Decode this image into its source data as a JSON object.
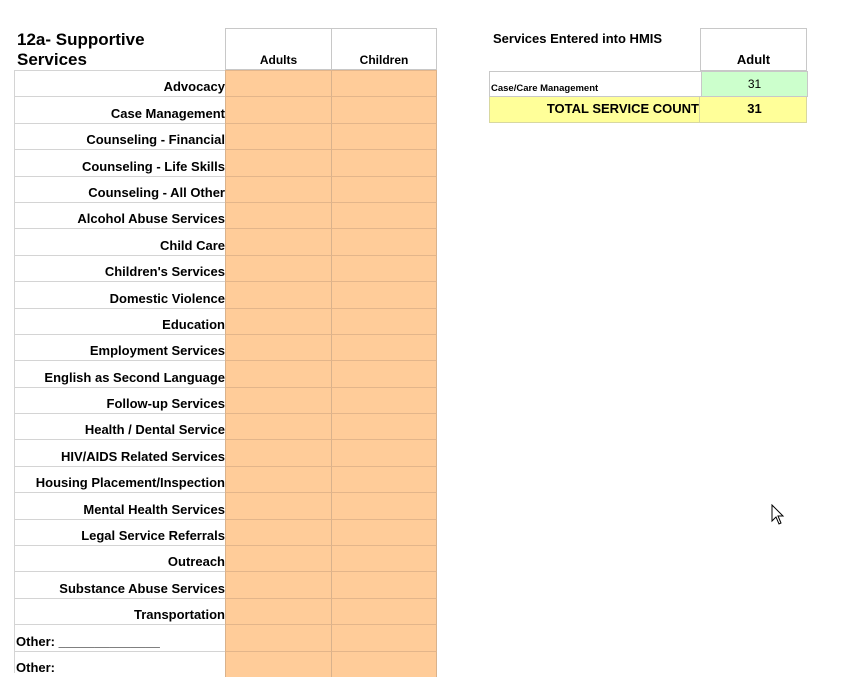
{
  "left_table": {
    "title": "12a- Supportive Services",
    "columns": {
      "adults": "Adults",
      "children": "Children"
    },
    "rows": [
      "Advocacy",
      "Case Management",
      "Counseling - Financial",
      "Counseling - Life Skills",
      "Counseling - All Other",
      "Alcohol Abuse Services",
      "Child Care",
      "Children's Services",
      "Domestic Violence",
      "Education",
      "Employment Services",
      "English as Second Language",
      "Follow-up Services",
      "Health / Dental Service",
      "HIV/AIDS Related Services",
      "Housing Placement/Inspection",
      "Mental Health Services",
      "Legal Service Referrals",
      "Outreach",
      "Substance Abuse Services",
      "Transportation",
      "Other: ______________",
      "Other:"
    ]
  },
  "right_table": {
    "title": "Services Entered into HMIS",
    "column": "Adult",
    "service_label": "Case/Care Management",
    "service_value": "31",
    "total_label": "TOTAL SERVICE COUNT",
    "total_value": "31"
  },
  "colors": {
    "input_cell": "#ffcc99",
    "service_cell": "#ccffcc",
    "total_row": "#ffff99"
  },
  "icons": {
    "cursor": "mouse-pointer-icon"
  }
}
